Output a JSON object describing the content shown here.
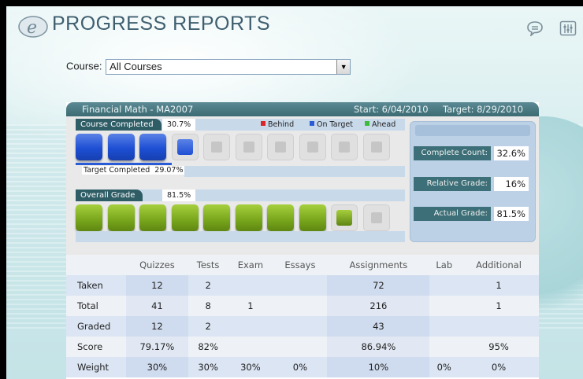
{
  "header": {
    "title": "PROGRESS REPORTS",
    "logo_glyph": "e"
  },
  "toolbar": {
    "chat_icon": "speech-bubble-icon",
    "settings_icon": "sliders-icon"
  },
  "course_filter": {
    "label": "Course:",
    "selected": "All Courses"
  },
  "course": {
    "name": "Financial Math - MA2007",
    "start": "Start: 6/04/2010",
    "target": "Target: 8/29/2010"
  },
  "completion": {
    "label": "Course Completed",
    "value": "30.7%",
    "boxes_filled": 3,
    "partial_box": true,
    "total_boxes": 10,
    "legend": {
      "behind": "Behind",
      "on_target": "On Target",
      "ahead": "Ahead"
    },
    "legend_colors": {
      "behind": "#d9262a",
      "on_target": "#2a5bd7",
      "ahead": "#3dbb3d"
    },
    "target_label": "Target Completed",
    "target_value": "29.07%",
    "target_fraction": 0.2907
  },
  "grade": {
    "label": "Overall Grade",
    "value": "81.5%",
    "boxes_filled": 8,
    "partial_box": true,
    "total_boxes": 10
  },
  "summary": {
    "complete_count_label": "Complete Count:",
    "complete_count": "32.6%",
    "relative_grade_label": "Relative Grade:",
    "relative_grade": "16%",
    "actual_grade_label": "Actual Grade:",
    "actual_grade": "81.5%"
  },
  "stats": {
    "columns": [
      "Quizzes",
      "Tests",
      "Exam",
      "Essays",
      "Assignments",
      "Lab",
      "Additional"
    ],
    "rows": [
      {
        "label": "Taken",
        "cells": [
          "12",
          "2",
          "",
          "",
          "72",
          "",
          "1"
        ]
      },
      {
        "label": "Total",
        "cells": [
          "41",
          "8",
          "1",
          "",
          "216",
          "",
          "1"
        ]
      },
      {
        "label": "Graded",
        "cells": [
          "12",
          "2",
          "",
          "",
          "43",
          "",
          ""
        ]
      },
      {
        "label": "Score",
        "cells": [
          "79.17%",
          "82%",
          "",
          "",
          "86.94%",
          "",
          "95%"
        ]
      },
      {
        "label": "Weight",
        "cells": [
          "30%",
          "30%",
          "30%",
          "0%",
          "10%",
          "0%",
          "0%"
        ]
      }
    ]
  }
}
